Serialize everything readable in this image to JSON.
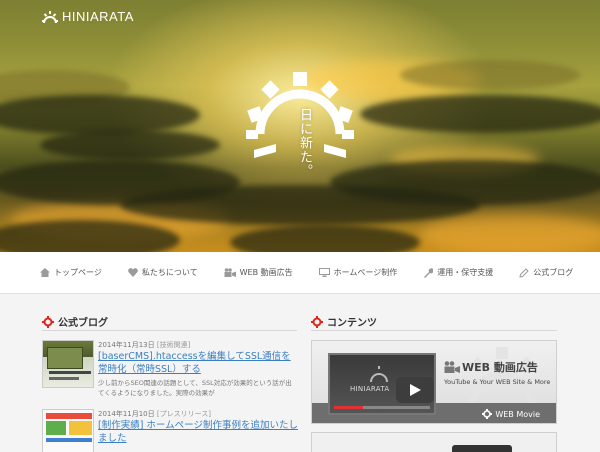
{
  "brand": {
    "name": "HINIARATA"
  },
  "hero": {
    "slogan": "日に新た。"
  },
  "nav": {
    "items": [
      {
        "label": "トップページ",
        "icon": "home-icon"
      },
      {
        "label": "私たちについて",
        "icon": "heart-icon"
      },
      {
        "label": "WEB 動画広告",
        "icon": "video-camera-icon"
      },
      {
        "label": "ホームページ制作",
        "icon": "monitor-icon"
      },
      {
        "label": "運用・保守支援",
        "icon": "wrench-icon"
      },
      {
        "label": "公式ブログ",
        "icon": "pen-icon"
      }
    ]
  },
  "blog": {
    "title": "公式ブログ",
    "posts": [
      {
        "date": "2014年11月13日",
        "category": "[技術関連]",
        "title": "[baserCMS].htaccessを編集してSSL通信を常時化（常時SSL）する",
        "excerpt": "少し前からSEO関連の話題として、SSL対応が効果的という話が出てくるようになりました。実際の効果が"
      },
      {
        "date": "2014年11月10日",
        "category": "[プレスリリース]",
        "title": "[制作実績] ホームページ制作事例を追加いたしました",
        "excerpt": ""
      }
    ]
  },
  "contents": {
    "title": "コンテンツ",
    "banner": {
      "title": "WEB 動画広告",
      "subtitle": "YouTube & Your WEB Site & More",
      "label": "WEB Movie",
      "mini_brand": "HINIARATA"
    }
  },
  "colors": {
    "accent": "#e0241b",
    "link": "#3a7fc4"
  }
}
